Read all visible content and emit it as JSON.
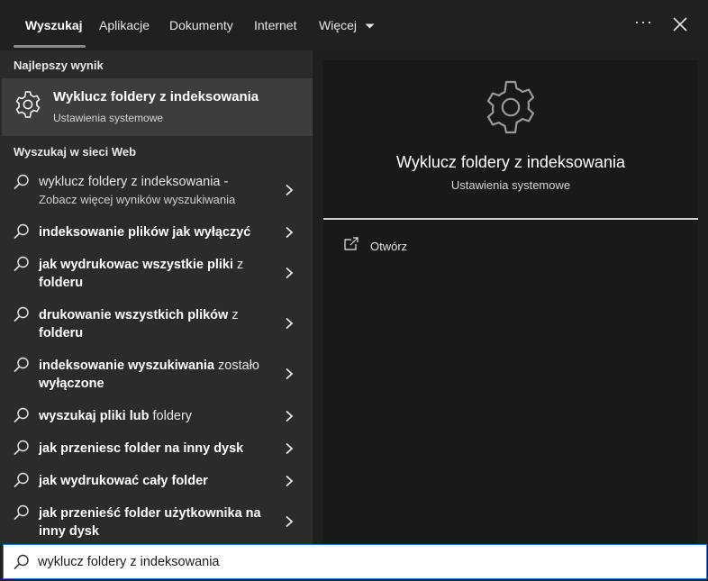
{
  "tabs": [
    {
      "label": "Wyszukaj"
    },
    {
      "label": "Aplikacje"
    },
    {
      "label": "Dokumenty"
    },
    {
      "label": "Internet"
    },
    {
      "label": "Więcej"
    }
  ],
  "icons": {
    "more": "more-dots-icon",
    "close": "close-icon",
    "settings": "gear-icon",
    "search": "search-icon",
    "chevron": "chevron-right-icon",
    "open": "open-external-icon",
    "dropdown": "chevron-down-icon"
  },
  "best_match": {
    "section_label": "Najlepszy wynik",
    "title": "Wyklucz foldery z indeksowania",
    "subtitle": "Ustawienia systemowe"
  },
  "web": {
    "section_label": "Wyszukaj w sieci Web",
    "items": [
      {
        "bold": "",
        "normal": "wyklucz foldery z indeksowania -",
        "sub": "Zobacz więcej wyników wyszukiwania"
      },
      {
        "bold": "indeksowanie plików jak wyłączyć",
        "normal": "",
        "sub": ""
      },
      {
        "bold": "jak wydrukowac wszystkie pliki",
        "normal": " z",
        "line2": "folderu"
      },
      {
        "bold": "drukowanie wszystkich plików",
        "normal": " z",
        "line2": "folderu"
      },
      {
        "bold": "indeksowanie wyszukiwania",
        "normal": " zostało",
        "line2": "wyłączone"
      },
      {
        "bold": "wyszukaj pliki lub",
        "normal": " foldery",
        "sub": ""
      },
      {
        "bold": "jak przeniesc folder na inny dysk",
        "normal": "",
        "sub": ""
      },
      {
        "bold": "jak wydrukować cały folder",
        "normal": "",
        "sub": ""
      },
      {
        "bold": "jak przenieść folder użytkownika na",
        "normal": "",
        "line2": "inny dysk"
      }
    ]
  },
  "preview": {
    "title": "Wyklucz foldery z indeksowania",
    "subtitle": "Ustawienia systemowe",
    "action_open": "Otwórz"
  },
  "search": {
    "value": "wyklucz foldery z indeksowania"
  },
  "colors": {
    "background": "#1f1f1f",
    "left_panel": "#2b2b2b",
    "selected": "#3d3d3d",
    "preview_panel": "#191919",
    "search_border": "#3a74c9"
  }
}
